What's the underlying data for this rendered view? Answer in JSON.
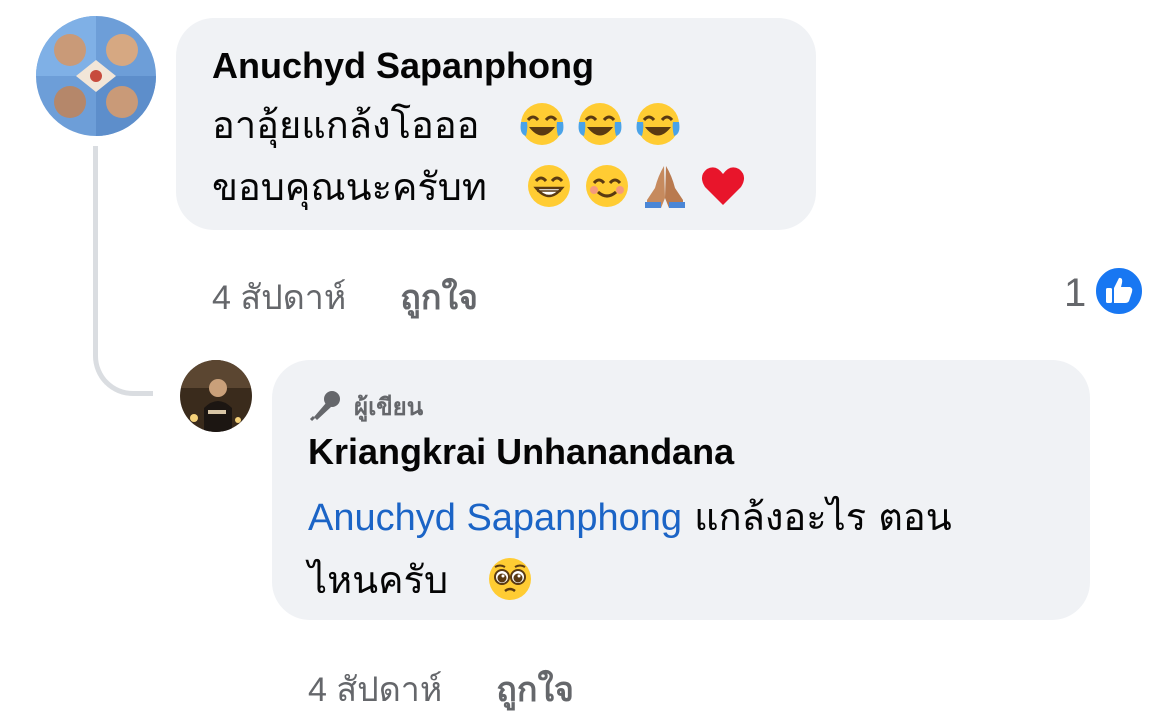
{
  "comments": [
    {
      "author": "Anuchyd Sapanphong",
      "lines": [
        "อาอุ้ยแกล้งโอออ",
        "ขอบคุณนะครับท"
      ],
      "emojis_line1": [
        "face-with-tears-of-joy",
        "face-with-tears-of-joy",
        "face-with-tears-of-joy"
      ],
      "emojis_line2": [
        "grinning-face",
        "smiling-face",
        "folded-hands",
        "red-heart"
      ],
      "time": "4 สัปดาห์",
      "like_label": "ถูกใจ",
      "reaction_count": "1",
      "reaction_icon": "thumbs-up-icon"
    },
    {
      "badge": "ผู้เขียน",
      "badge_icon": "microphone-icon",
      "author": "Kriangkrai Unhanandana",
      "mention": "Anuchyd Sapanphong",
      "text_line1": " แกล้งอะไร ตอน",
      "text_line2": "ไหนครับ",
      "emojis_line2": [
        "pleading-face"
      ],
      "time": "4 สัปดาห์",
      "like_label": "ถูกใจ"
    }
  ],
  "colors": {
    "bubble": "#f0f2f5",
    "mention": "#1b64c6",
    "secondary_text": "#65676b",
    "like_blue": "#1877f2"
  }
}
